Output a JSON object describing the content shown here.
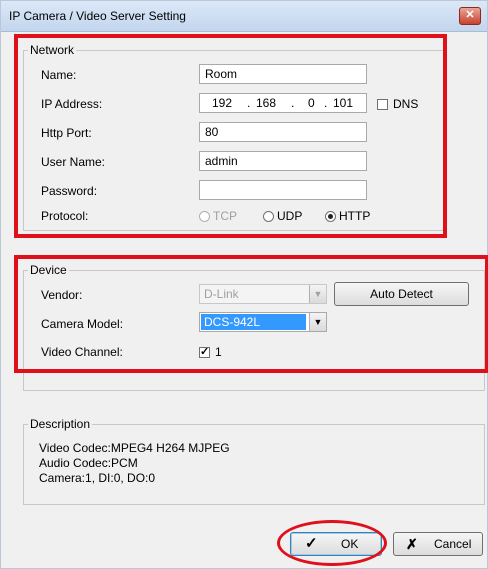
{
  "window": {
    "title": "IP Camera / Video Server Setting",
    "close_glyph": "✕"
  },
  "network": {
    "legend": "Network",
    "name_label": "Name:",
    "name_value": "Room",
    "ip_label": "IP Address:",
    "ip_octets": [
      "192",
      "168",
      "0",
      "101"
    ],
    "dns_label": "DNS",
    "http_port_label": "Http Port:",
    "http_port_value": "80",
    "user_label": "User Name:",
    "user_value": "admin",
    "password_label": "Password:",
    "password_value": "",
    "protocol_label": "Protocol:",
    "protocols": [
      "TCP",
      "UDP",
      "HTTP"
    ],
    "selected_protocol": "HTTP"
  },
  "device": {
    "legend": "Device",
    "vendor_label": "Vendor:",
    "vendor_value": "D-Link",
    "auto_detect_label": "Auto Detect",
    "camera_model_label": "Camera Model:",
    "camera_model_value": "DCS-942L",
    "video_channel_label": "Video Channel:",
    "video_channel_value": "1"
  },
  "description": {
    "legend": "Description",
    "lines": [
      "Video Codec:MPEG4 H264 MJPEG",
      "Audio Codec:PCM",
      "Camera:1, DI:0, DO:0"
    ]
  },
  "buttons": {
    "ok_label": "OK",
    "cancel_label": "Cancel"
  },
  "colors": {
    "highlight_red": "#e0101a",
    "selection_blue": "#3399ff"
  }
}
